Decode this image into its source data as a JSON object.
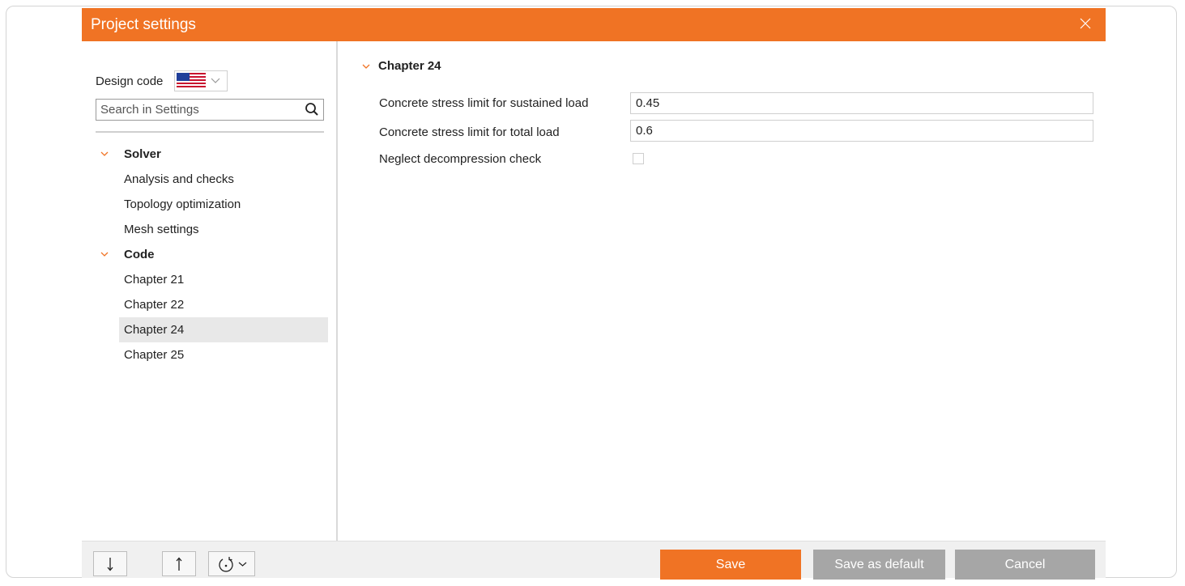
{
  "window": {
    "title": "Project settings"
  },
  "sidebar": {
    "design_code_label": "Design code",
    "design_code_flag": "us-flag-icon",
    "search_placeholder": "Search in Settings",
    "groups": [
      {
        "label": "Solver",
        "items": [
          "Analysis and checks",
          "Topology optimization",
          "Mesh settings"
        ]
      },
      {
        "label": "Code",
        "items": [
          "Chapter 21",
          "Chapter 22",
          "Chapter 24",
          "Chapter 25"
        ]
      }
    ],
    "selected_item": "Chapter 24"
  },
  "main": {
    "section_title": "Chapter 24",
    "properties": [
      {
        "label": "Concrete stress limit for sustained load",
        "value": "0.45"
      },
      {
        "label": "Concrete stress limit for total load",
        "value": "0.6"
      }
    ],
    "checkbox": {
      "label": "Neglect decompression check",
      "checked": false
    }
  },
  "footer": {
    "save_label": "Save",
    "save_default_label": "Save as default",
    "cancel_label": "Cancel",
    "icons": [
      "arrow-down-icon",
      "arrow-up-icon",
      "reset-icon"
    ]
  },
  "colors": {
    "accent": "#f07324",
    "disabled_button": "#a6a6a6",
    "selection": "#e8e8e8"
  }
}
